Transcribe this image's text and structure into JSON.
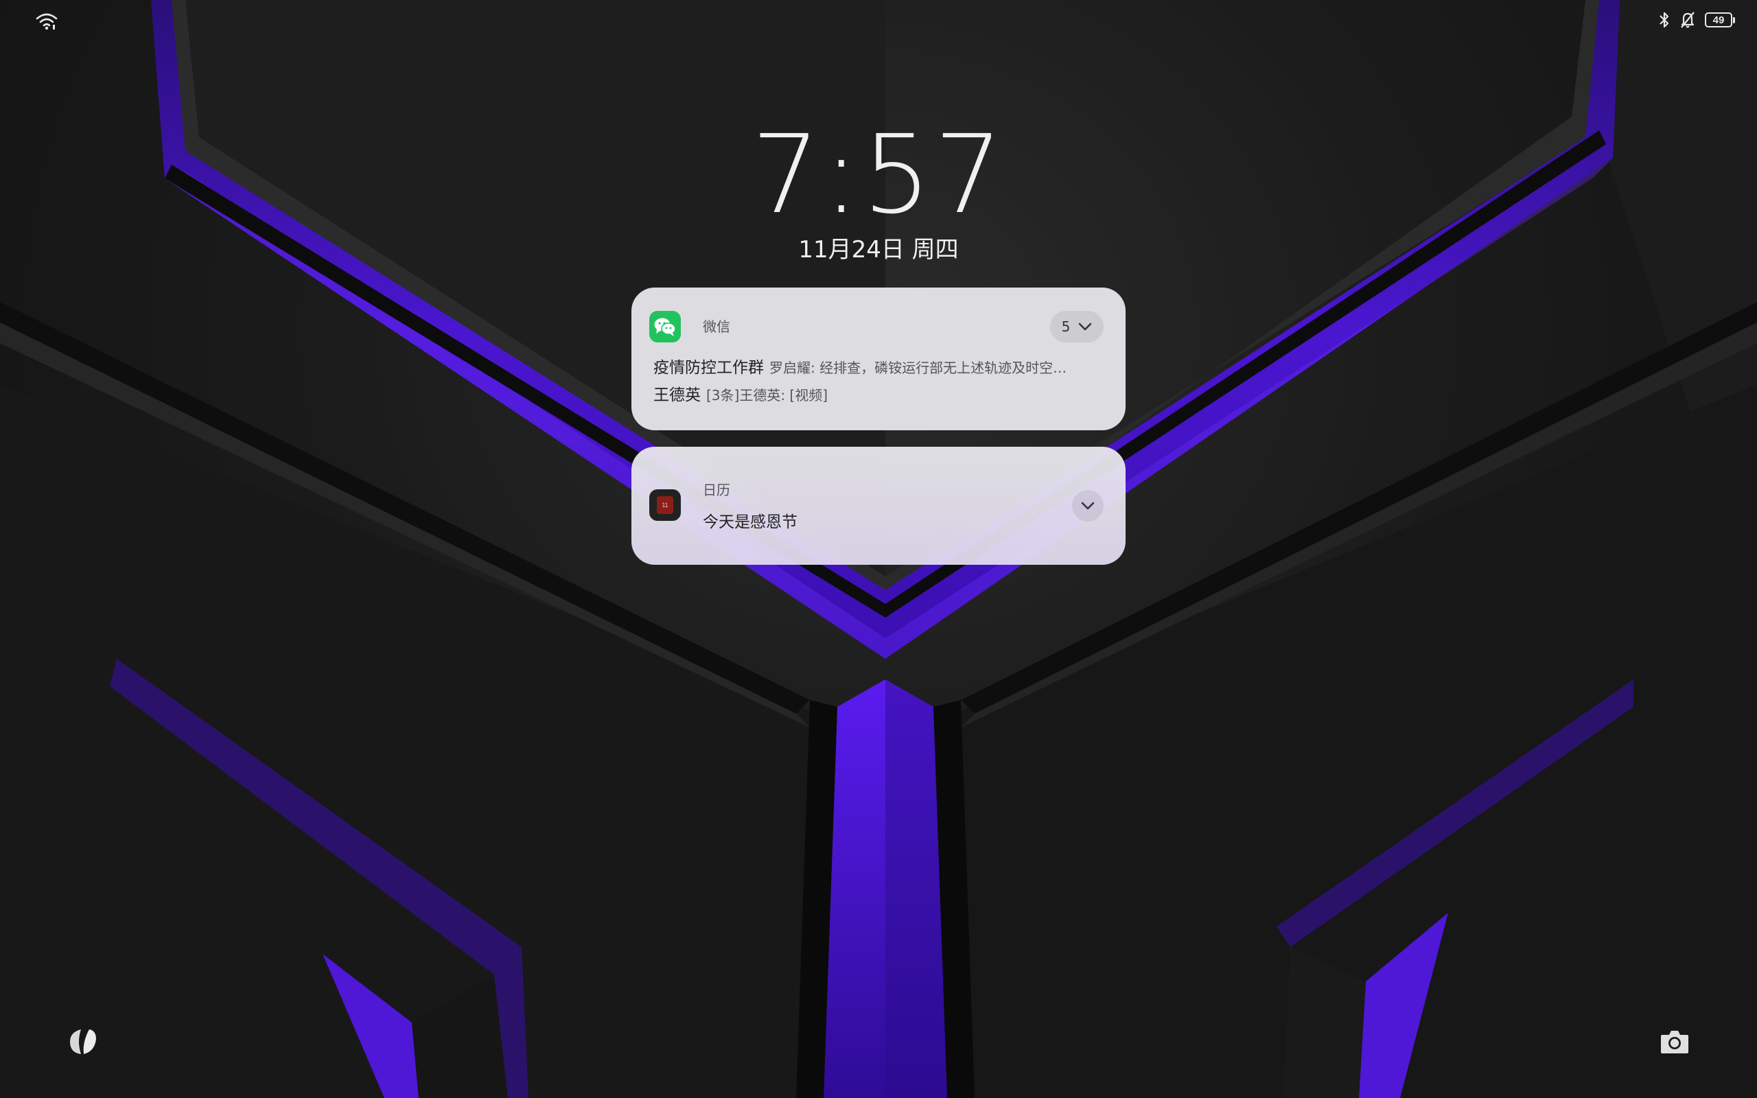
{
  "status_bar": {
    "left_icons": [
      "wifi-icon"
    ],
    "right_icons": [
      "bluetooth-icon",
      "bell-muted-icon",
      "battery-icon"
    ],
    "battery_level": "49"
  },
  "lock_screen": {
    "time": "7:57",
    "date": "11月24日 周四"
  },
  "notifications": [
    {
      "app": "微信",
      "icon": "wechat-icon",
      "count": "5",
      "messages": [
        {
          "sender": "疫情防控工作群",
          "text": "罗启耀: 经排查，磷铵运行部无上述轨迹及时空…"
        },
        {
          "sender": "王德英",
          "text": "[3条]王德英: [视频]"
        }
      ]
    },
    {
      "app": "日历",
      "icon": "calendar-icon",
      "icon_text": "11",
      "text": "今天是感恩节"
    }
  ],
  "bottom": {
    "left_icon": "leaf-icon",
    "right_icon": "camera-icon"
  },
  "colors": {
    "accent_purple": "#4f17d6",
    "wechat_green": "#22c35e"
  }
}
